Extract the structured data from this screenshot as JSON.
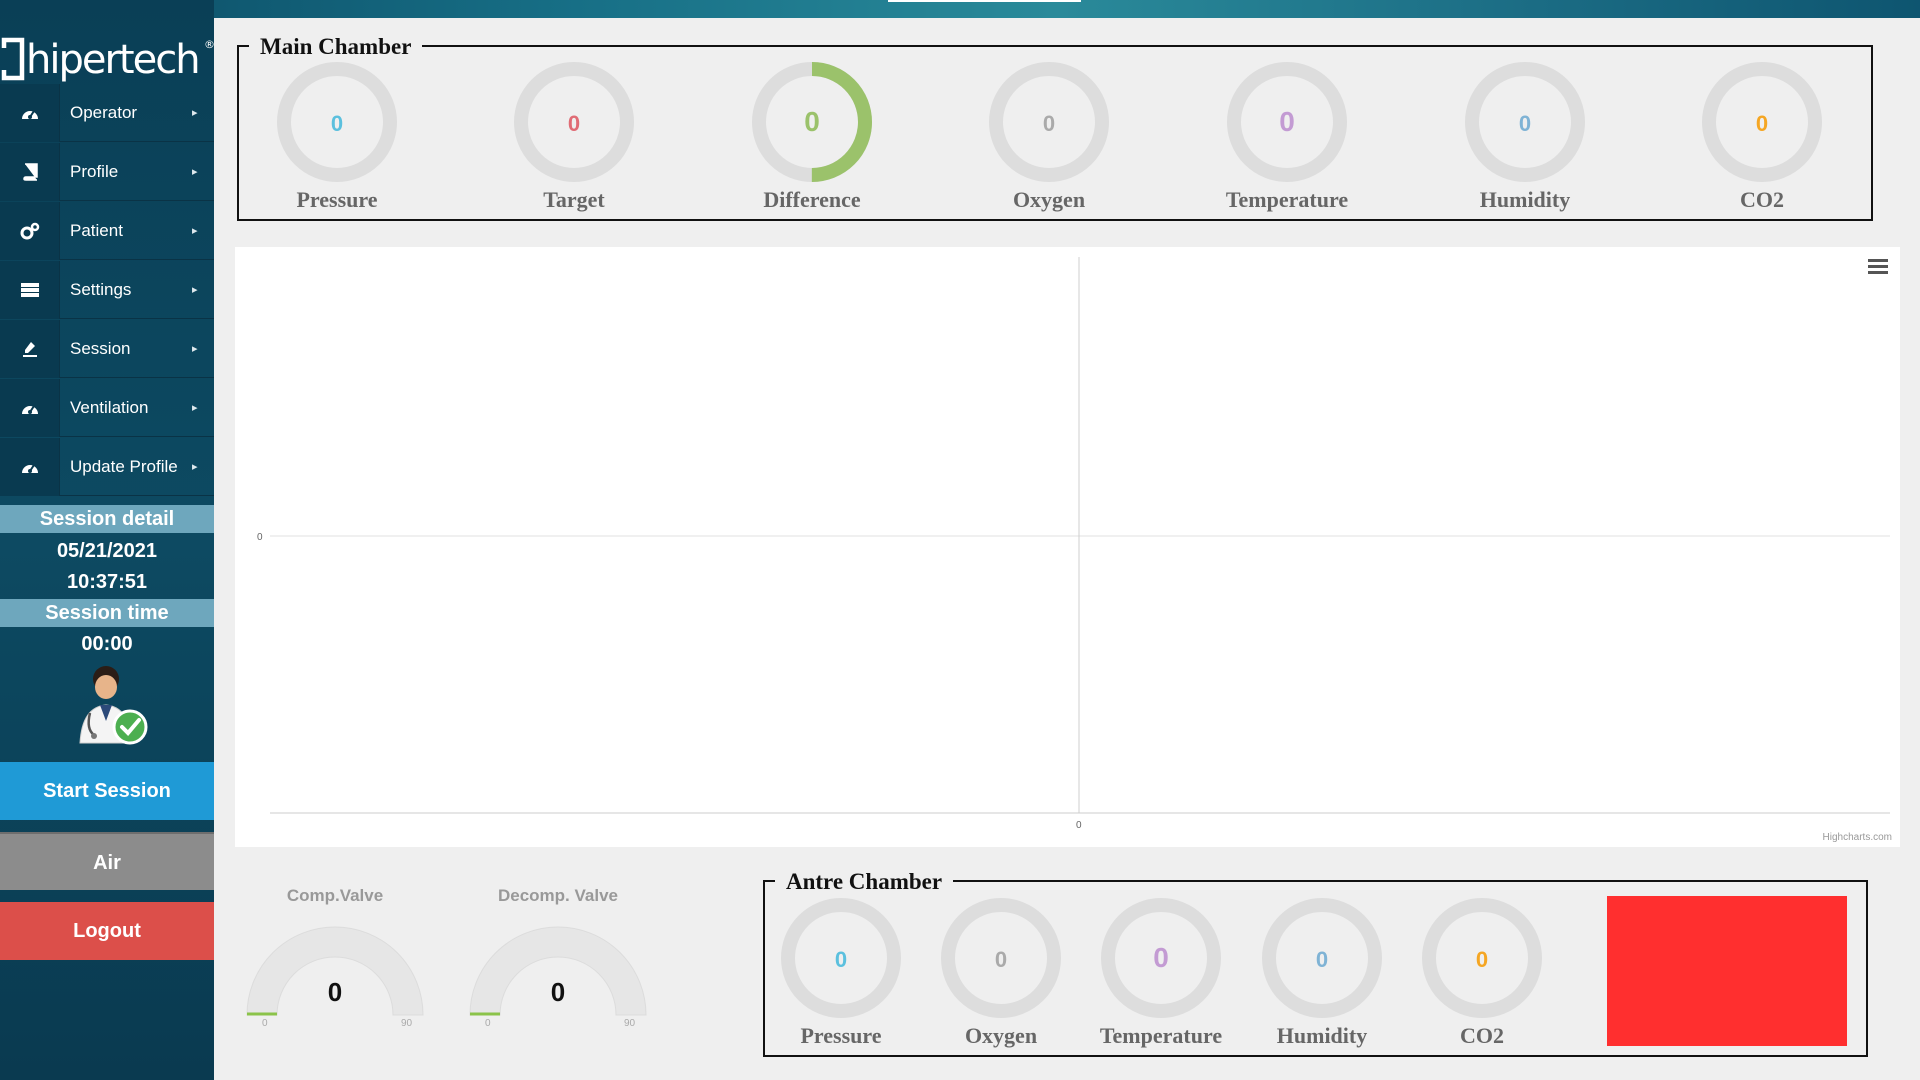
{
  "app": {
    "logo_text": "hipertech",
    "registered_mark": "®"
  },
  "sidebar": {
    "items": [
      {
        "label": "Operator",
        "icon": "dashboard-icon"
      },
      {
        "label": "Profile",
        "icon": "book-icon"
      },
      {
        "label": "Patient",
        "icon": "cogs-icon"
      },
      {
        "label": "Settings",
        "icon": "server-icon"
      },
      {
        "label": "Session",
        "icon": "pen-icon"
      },
      {
        "label": "Ventilation",
        "icon": "dashboard-icon"
      },
      {
        "label": "Update Profile",
        "icon": "dashboard-icon"
      }
    ],
    "session_detail_title": "Session detail",
    "session_date": "05/21/2021",
    "session_clock": "10:37:51",
    "session_time_title": "Session time",
    "session_time_value": "00:00",
    "buttons": {
      "start": "Start Session",
      "air": "Air",
      "logout": "Logout"
    }
  },
  "main_chamber": {
    "title": "Main Chamber",
    "gauges": [
      {
        "label": "Pressure",
        "value": "0",
        "color": "#5bc0de",
        "fill": 0
      },
      {
        "label": "Target",
        "value": "0",
        "color": "#e06c75",
        "fill": 0
      },
      {
        "label": "Difference",
        "value": "0",
        "color": "#9bc26b",
        "fill": 0.5
      },
      {
        "label": "Oxygen",
        "value": "0",
        "color": "#aaaaaa",
        "fill": 0
      },
      {
        "label": "Temperature",
        "value": "0",
        "color": "#c39bd3",
        "fill": 0
      },
      {
        "label": "Humidity",
        "value": "0",
        "color": "#7fb3d5",
        "fill": 0
      },
      {
        "label": "CO2",
        "value": "0",
        "color": "#f5a623",
        "fill": 0
      }
    ]
  },
  "chart": {
    "y_tick": "0",
    "x_tick": "0",
    "credit": "Highcharts.com",
    "menu_icon": "hamburger-icon"
  },
  "valves": {
    "comp": {
      "title": "Comp.Valve",
      "value": "0",
      "min": "0",
      "max": "90"
    },
    "decomp": {
      "title": "Decomp. Valve",
      "value": "0",
      "min": "0",
      "max": "90"
    }
  },
  "antre_chamber": {
    "title": "Antre Chamber",
    "gauges": [
      {
        "label": "Pressure",
        "value": "0",
        "color": "#5bc0de"
      },
      {
        "label": "Oxygen",
        "value": "0",
        "color": "#aaaaaa"
      },
      {
        "label": "Temperature",
        "value": "0",
        "color": "#c39bd3"
      },
      {
        "label": "Humidity",
        "value": "0",
        "color": "#7fb3d5"
      },
      {
        "label": "CO2",
        "value": "0",
        "color": "#f5a623"
      }
    ],
    "status_color": "#ff2f2f"
  }
}
